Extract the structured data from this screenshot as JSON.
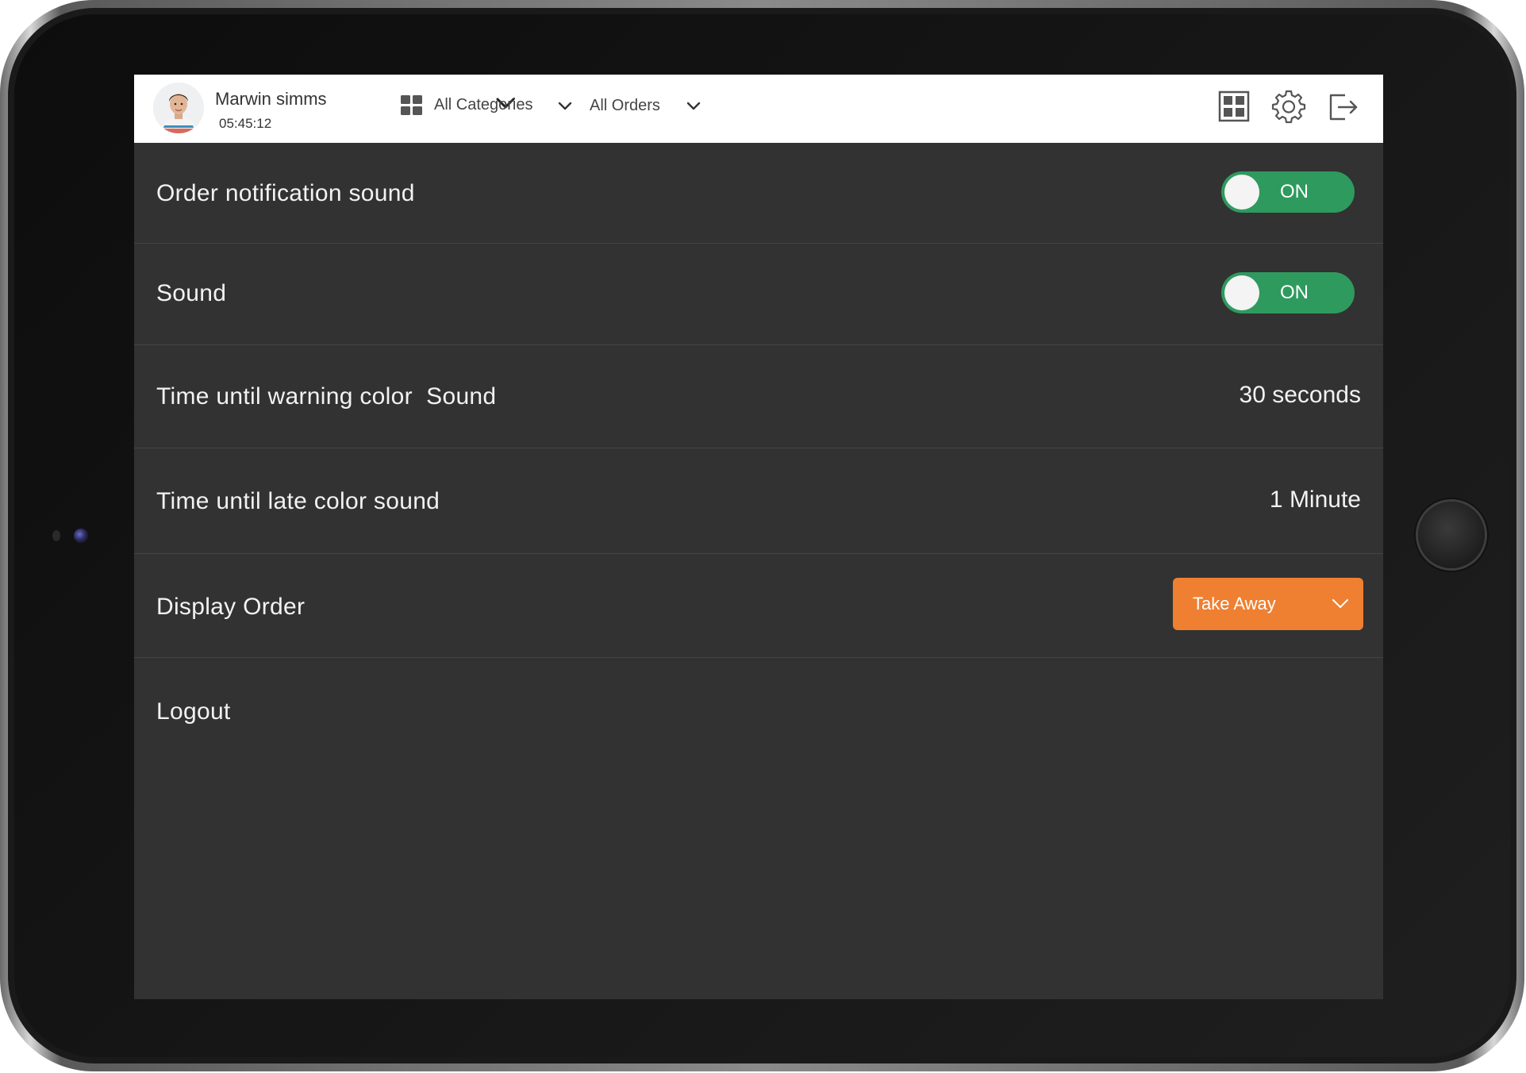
{
  "header": {
    "user_name": "Marwin simms",
    "user_time": "05:45:12",
    "category_filter": "All Categories",
    "order_filter": "All Orders",
    "icons": [
      "grid-view-icon",
      "gear-icon",
      "logout-icon"
    ]
  },
  "settings": {
    "order_notification_sound": {
      "label": "Order notification sound",
      "state": "ON"
    },
    "sound": {
      "label": "Sound",
      "state": "ON"
    },
    "warning_time": {
      "label": "Time until warning color  Sound",
      "value": "30 seconds"
    },
    "late_time": {
      "label": "Time until late color sound",
      "value": "1 Minute"
    },
    "display_order": {
      "label": "Display Order",
      "selected": "Take Away"
    },
    "logout": {
      "label": "Logout"
    }
  },
  "colors": {
    "toggle_on": "#2e9a5e",
    "dropdown_accent": "#ef7f31",
    "screen_bg": "#323232",
    "header_bg": "#ffffff"
  }
}
